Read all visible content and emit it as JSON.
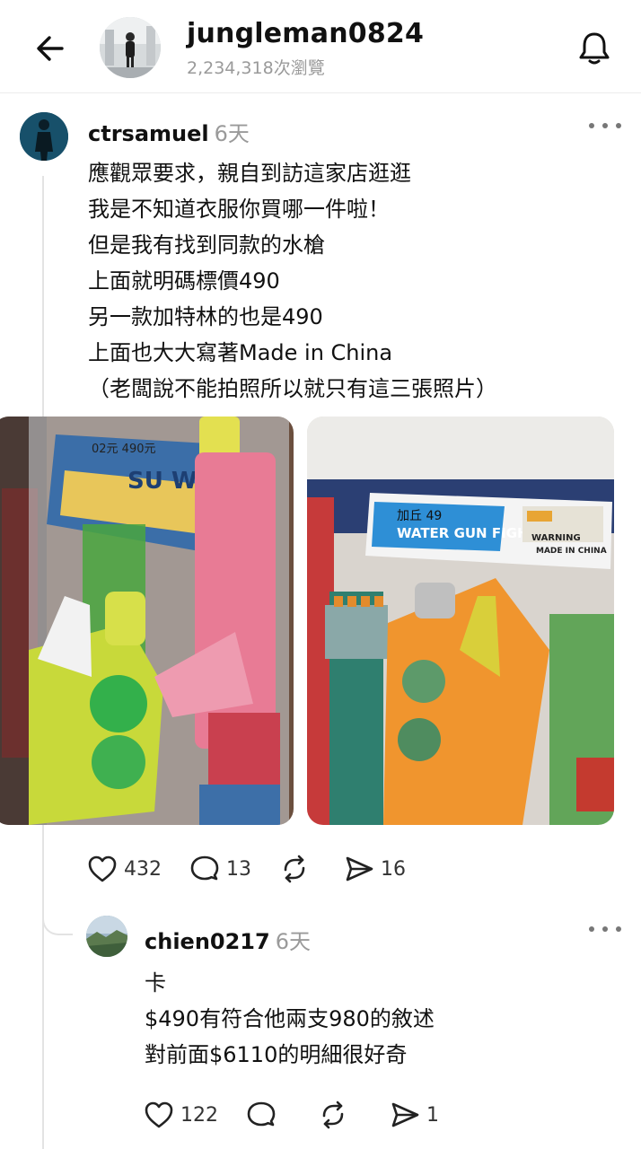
{
  "header": {
    "title": "jungleman0824",
    "views": "2,234,318次瀏覽"
  },
  "post": {
    "username": "ctrsamuel",
    "time": "6天",
    "lines": [
      "應觀眾要求，親自到訪這家店逛逛",
      "我是不知道衣服你買哪一件啦！",
      "但是我有找到同款的水槍",
      "上面就明碼標價490",
      "另一款加特林的也是490",
      "上面也大大寫著Made in China",
      "（老闆說不能拍照所以就只有這三張照片）"
    ],
    "photo2_label": {
      "price_note": "加丘 49",
      "brand": "WATER GUN FIGHTER",
      "made_in": "MADE IN CHINA",
      "warning": "WARNING"
    },
    "photo1_label": {
      "price_note": "02元 490元",
      "brand": "SU WAT"
    },
    "likes": "432",
    "comments": "13",
    "shares": "16"
  },
  "reply": {
    "username": "chien0217",
    "time": "6天",
    "lines": [
      "卡",
      "$490有符合他兩支980的敘述",
      "對前面$6110的明細很好奇"
    ],
    "likes": "122",
    "shares": "1"
  },
  "icons": {
    "back": "arrow-left-icon",
    "bell": "bell-icon",
    "more": "more-horizontal-icon",
    "like": "heart-icon",
    "comment": "comment-icon",
    "repost": "repost-icon",
    "share": "send-icon"
  }
}
